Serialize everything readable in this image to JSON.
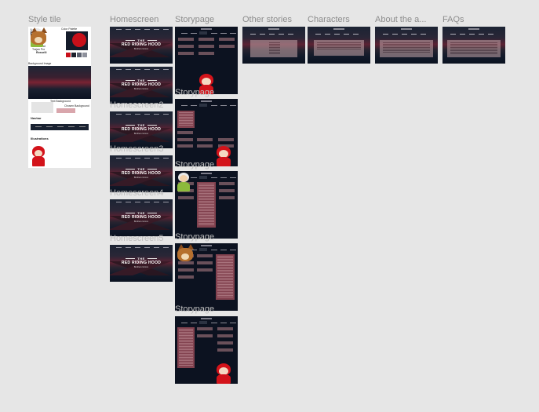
{
  "columns": {
    "style_tile": "Style tile",
    "homescreen": "Homescreen",
    "storypage": "Storypage",
    "other_stories": "Other stories",
    "characters": "Characters",
    "about": "About the a...",
    "faqs": "FAQs"
  },
  "frame_labels": {
    "home2": "Homescreen2",
    "home3": "Homescreen3",
    "home4": "Homescreen4",
    "home5": "Homescreen5",
    "story2": "Storypage",
    "story3": "Storypage",
    "story4": "Storypage",
    "story5": "Storypage"
  },
  "style_tile": {
    "logo": "Logo",
    "color_palette": "Color Palette",
    "fonts": "Fonts",
    "font1": "Montserrat",
    "font2": "Trajan Pro",
    "font3": "Rosselli",
    "background_image": "Background Image",
    "text_background": "Text Background",
    "chosen_background": "Chosen Background",
    "navbar": "Navbar",
    "illustrations": "Illustrations",
    "colors": [
      "#c8101a",
      "#1b1f2b",
      "#5a5f6e",
      "#8e919c",
      "#24283a"
    ]
  },
  "homescreen": {
    "the": "THE",
    "title": "RED RIDING HOOD",
    "subtitle": "Brothers Grimm"
  }
}
